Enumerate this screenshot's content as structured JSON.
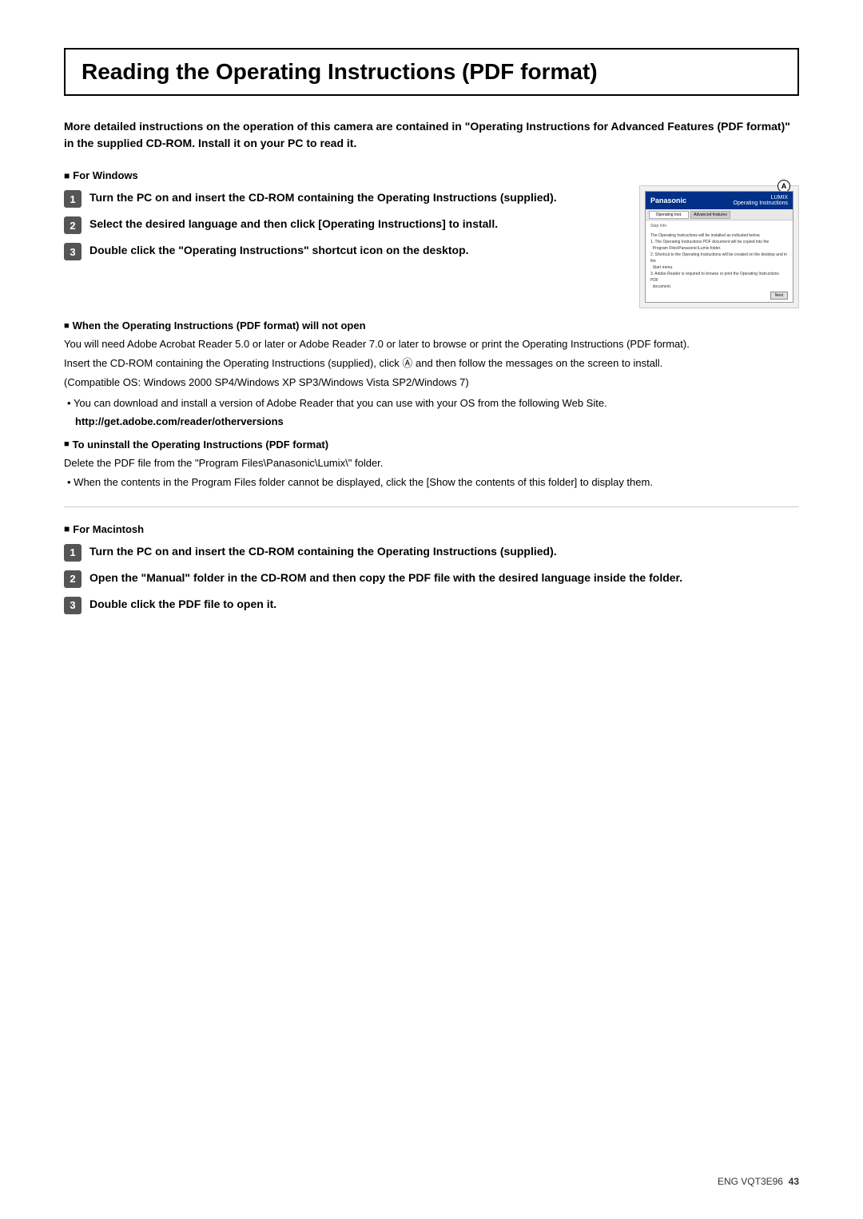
{
  "page": {
    "title": "Reading the Operating Instructions (PDF format)",
    "intro": "More detailed instructions on the operation of this camera are contained in \"Operating Instructions for Advanced Features (PDF format)\" in the supplied CD-ROM. Install it on your PC to read it.",
    "windows_section_label": "For Windows",
    "macintosh_section_label": "For Macintosh",
    "footer": "ENG VQT3E96",
    "page_number": "43"
  },
  "steps_windows": {
    "step1": {
      "num": "1",
      "text": "Turn the PC on and insert the CD-ROM containing the Operating Instructions (supplied)."
    },
    "step2": {
      "num": "2",
      "text": "Select the desired language and then click [Operating Instructions] to install."
    },
    "step3": {
      "num": "3",
      "text": "Double click the \"Operating Instructions\" shortcut icon on the desktop."
    }
  },
  "steps_macintosh": {
    "step1": {
      "num": "1",
      "text": "Turn the PC on and insert the CD-ROM containing the Operating Instructions (supplied)."
    },
    "step2": {
      "num": "2",
      "text": "Open the \"Manual\" folder in the CD-ROM and then copy the PDF file with the desired language inside the folder."
    },
    "step3": {
      "num": "3",
      "text": "Double click the PDF file to open it."
    }
  },
  "when_not_open": {
    "header": "When the Operating Instructions (PDF format) will not open",
    "body1": "You will need Adobe Acrobat Reader 5.0 or later or Adobe Reader 7.0 or later to browse or print the Operating Instructions (PDF format).",
    "body2": "Insert the CD-ROM containing the Operating Instructions (supplied), click Ⓐ and then follow the messages on the screen to install.",
    "body3": "(Compatible OS: Windows 2000 SP4/Windows XP SP3/Windows Vista SP2/Windows 7)",
    "bullet1": "You can download and install a version of Adobe Reader that you can use with your OS from the following Web Site.",
    "website": "http://get.adobe.com/reader/otherversions"
  },
  "uninstall": {
    "header": "To uninstall the Operating Instructions (PDF format)",
    "body1": "Delete the PDF file from the \"Program Files\\Panasonic\\Lumix\\\" folder.",
    "bullet1": "When the contents in the Program Files folder cannot be displayed, click the [Show the contents of this folder] to display them."
  },
  "screenshot": {
    "topbar_left": "Panasonic",
    "topbar_right": "LUMIX\nOperating Instructions",
    "tab1": "Operating Instructions",
    "tab2": "Advanced features",
    "circle_label": "Ⓐ"
  }
}
